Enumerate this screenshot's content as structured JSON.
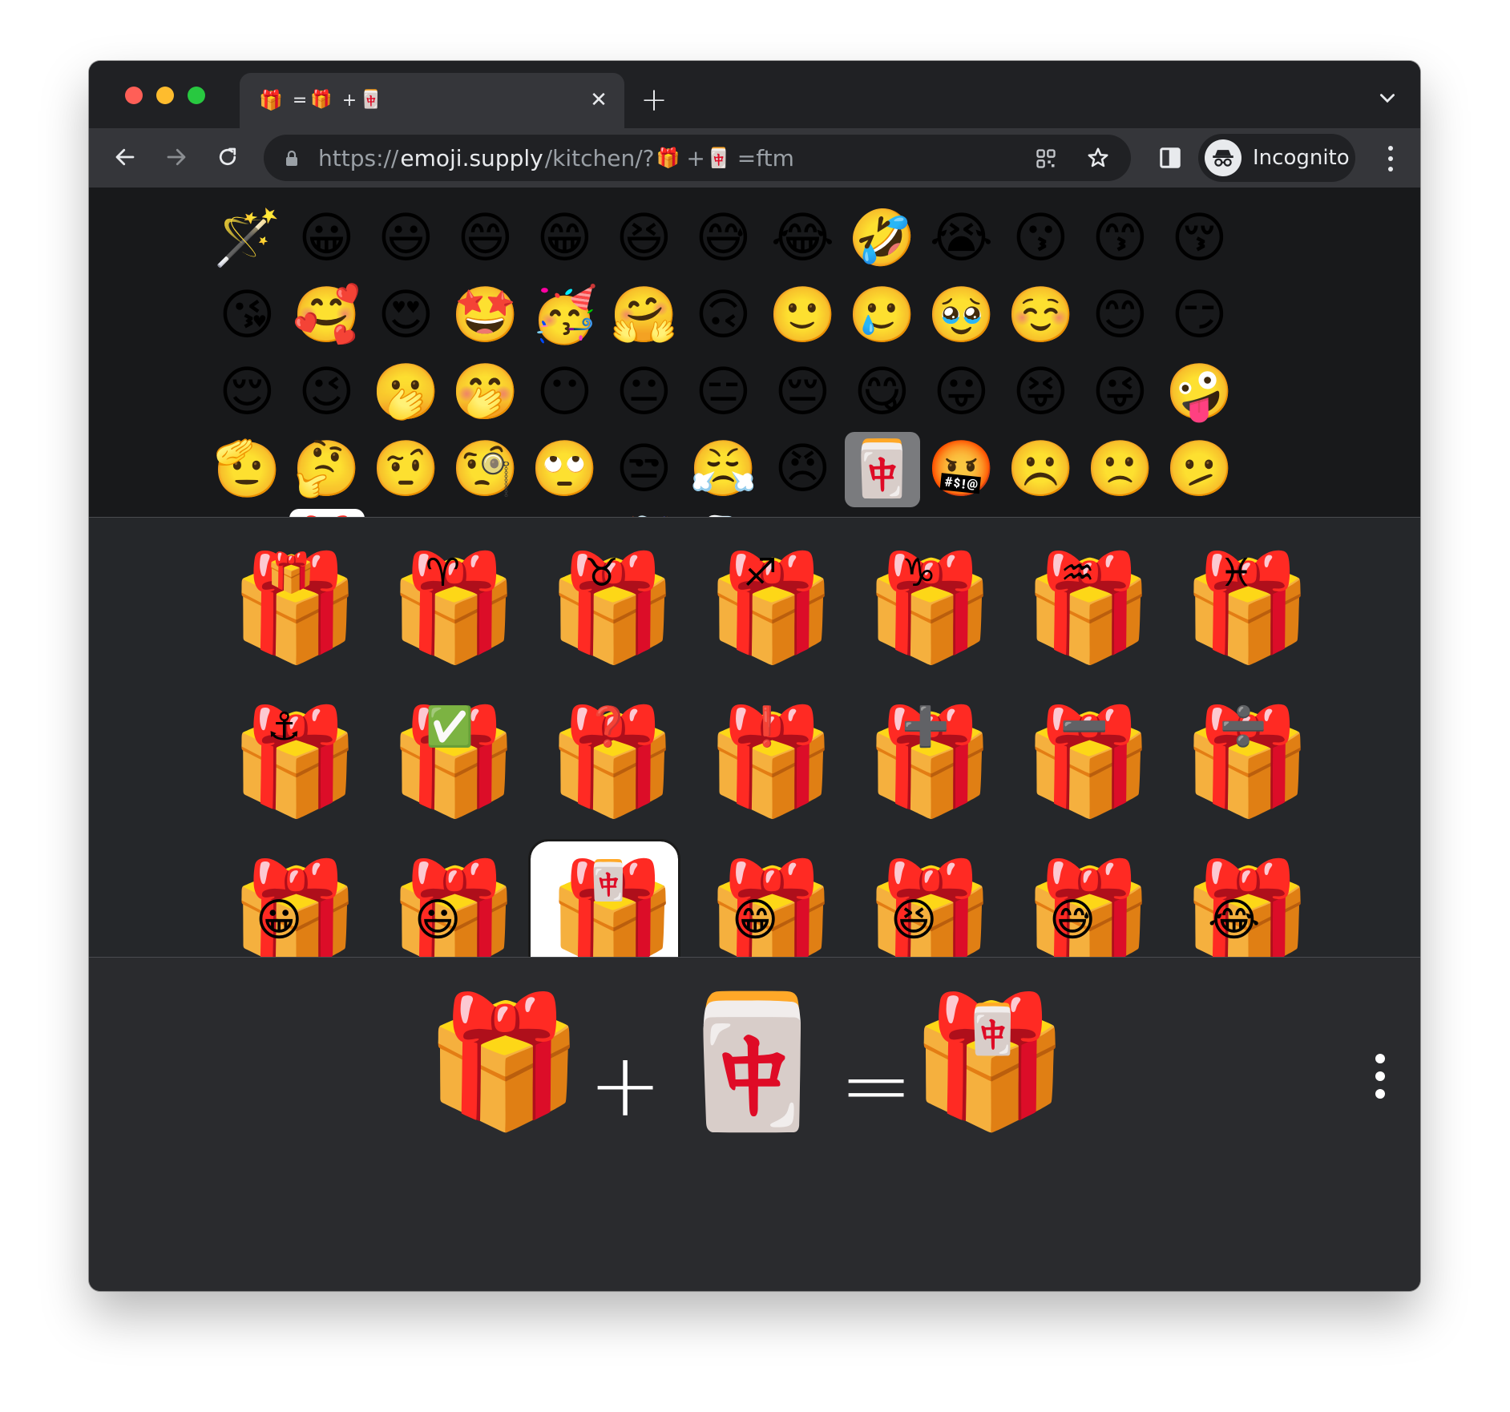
{
  "tab": {
    "icon": "combined-emoji-icon",
    "title_parts": [
      "=",
      "🎁",
      "+",
      "🀄"
    ]
  },
  "address": {
    "scheme": "https://",
    "host": "emoji.supply",
    "path_start": "/kitchen/?",
    "emoji_a": "🎁",
    "plus": "+",
    "emoji_b": "🀄",
    "path_end": "=ftm"
  },
  "profile": {
    "label": "Incognito"
  },
  "picker": {
    "emojis": [
      "🪄",
      "😀",
      "😃",
      "😄",
      "😁",
      "😆",
      "😅",
      "😂",
      "🤣",
      "😭",
      "😗",
      "😙",
      "😚",
      "😘",
      "🥰",
      "😍",
      "🤩",
      "🥳",
      "🤗",
      "🙃",
      "🙂",
      "🥲",
      "🥹",
      "☺️",
      "😊",
      "😏",
      "😌",
      "😉",
      "🫢",
      "🤭",
      "😶",
      "😐",
      "😑",
      "😔",
      "😋",
      "😛",
      "😝",
      "😜",
      "🤪",
      "🫡",
      "🤔",
      "🤨",
      "🧐",
      "🙄",
      "😒",
      "😤",
      "😠",
      "🀄",
      "🤬",
      "☹️",
      "🙁",
      "🫤",
      "😕",
      "🎁",
      "🥺",
      "😳",
      "😱",
      "🤯",
      "🥶",
      "🥵",
      "😡",
      "🤒",
      "🤕",
      "🤢",
      "🤧",
      "😷",
      "🤠",
      "🤓",
      "😎",
      "😵"
    ],
    "selected_a": "🎁",
    "selected_b": "🀄"
  },
  "combinations": {
    "rows": [
      [
        "🎁",
        "♈",
        "♉",
        "♐",
        "♑",
        "♒",
        "♓"
      ],
      [
        "⚓",
        "✅",
        "❓",
        "❗",
        "➕",
        "➖",
        "➗"
      ],
      [
        "😀",
        "😃",
        "🀄",
        "😁",
        "😆",
        "😅",
        "😂"
      ],
      [
        "🎀",
        "🎁",
        "🎁",
        "🎁",
        "🎁",
        "🎁",
        "🎁"
      ]
    ],
    "selected": "🀄"
  },
  "result": {
    "left": "🎁",
    "plus": "+",
    "right": "🀄",
    "equals": "=",
    "result": "🀄"
  }
}
